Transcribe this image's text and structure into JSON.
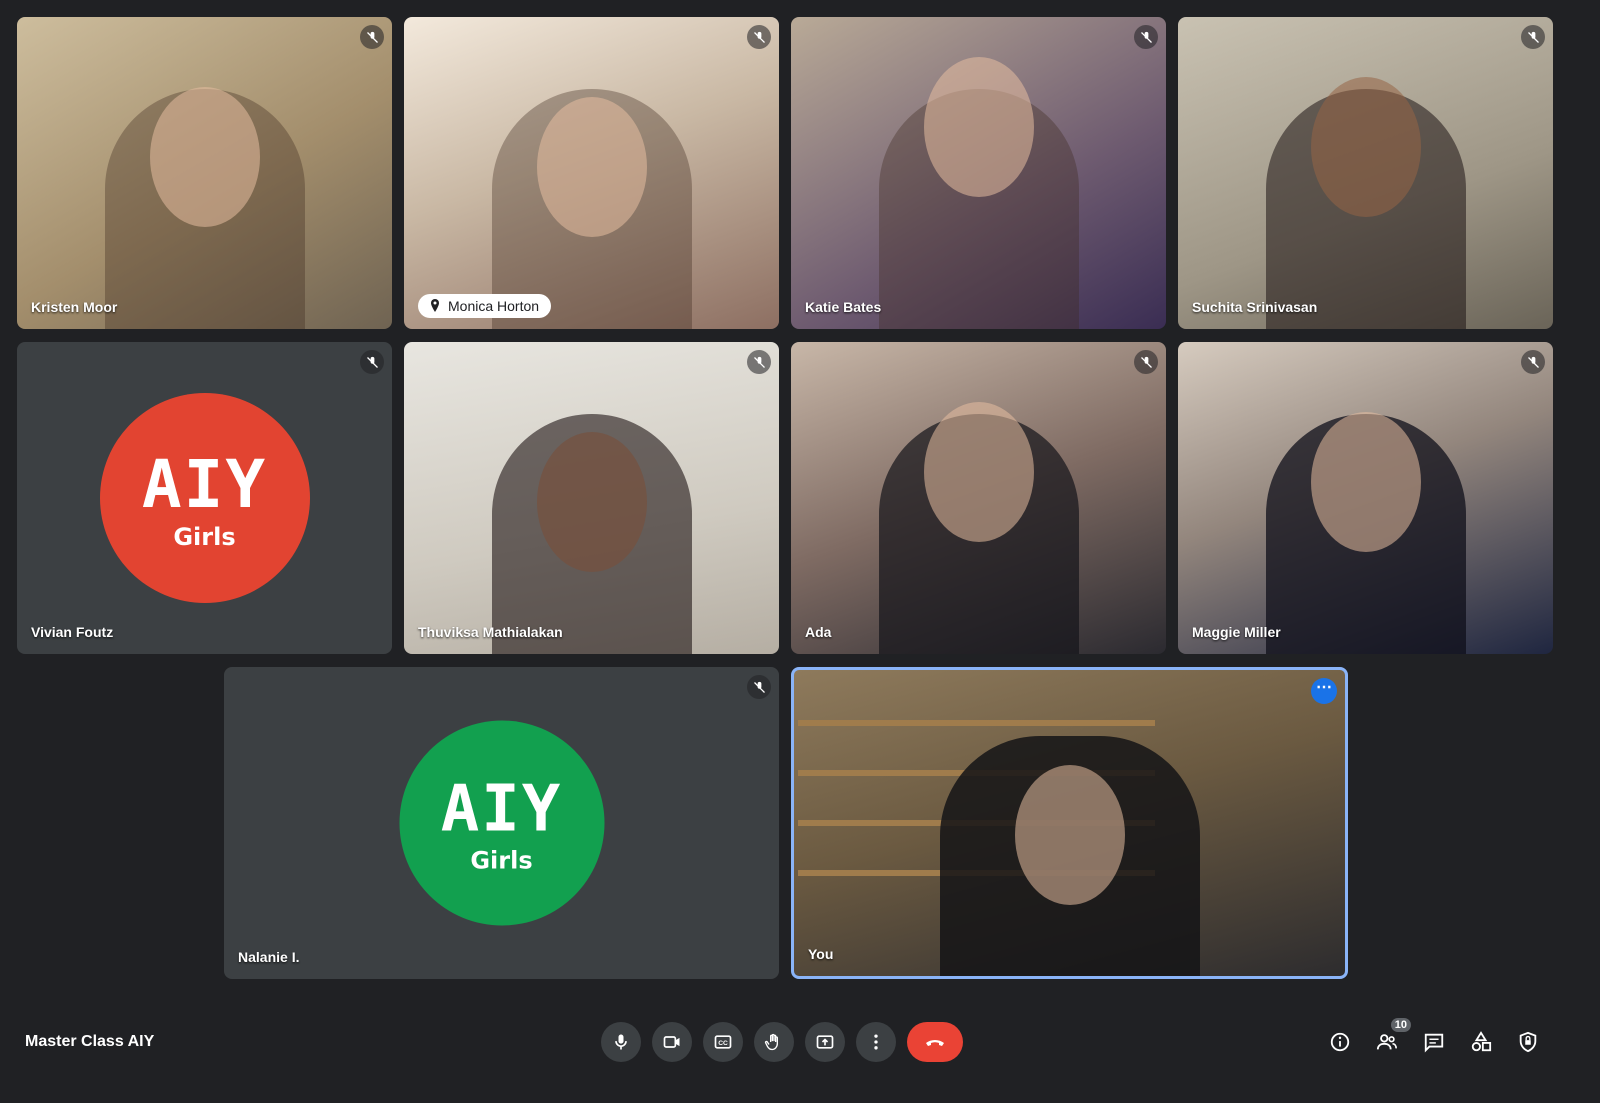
{
  "meeting": {
    "title": "Master Class AIY"
  },
  "participants": [
    {
      "name": "Kristen Moor"
    },
    {
      "name": "Monica Horton"
    },
    {
      "name": "Katie Bates"
    },
    {
      "name": "Suchita Srinivasan"
    },
    {
      "name": "Vivian Foutz",
      "avatar_text": "AIY",
      "avatar_sub": "Girls",
      "avatar_color": "#e24431"
    },
    {
      "name": "Thuviksa Mathialakan"
    },
    {
      "name": "Ada"
    },
    {
      "name": "Maggie Miller"
    },
    {
      "name": "Nalanie I.",
      "avatar_text": "AIY",
      "avatar_sub": "Girls",
      "avatar_color": "#12a04f"
    },
    {
      "name": "You"
    }
  ],
  "people_count": "10",
  "colors": {
    "background": "#202124",
    "hangup": "#ea4335",
    "self_border": "#8ab4f8",
    "accent": "#1a73e8"
  },
  "controls": [
    "mic-icon",
    "camera-icon",
    "captions-icon",
    "raise-hand-icon",
    "present-icon",
    "more-options-icon",
    "hangup-icon"
  ],
  "right_controls": [
    "info-icon",
    "people-icon",
    "chat-icon",
    "activities-icon",
    "host-controls-icon"
  ]
}
